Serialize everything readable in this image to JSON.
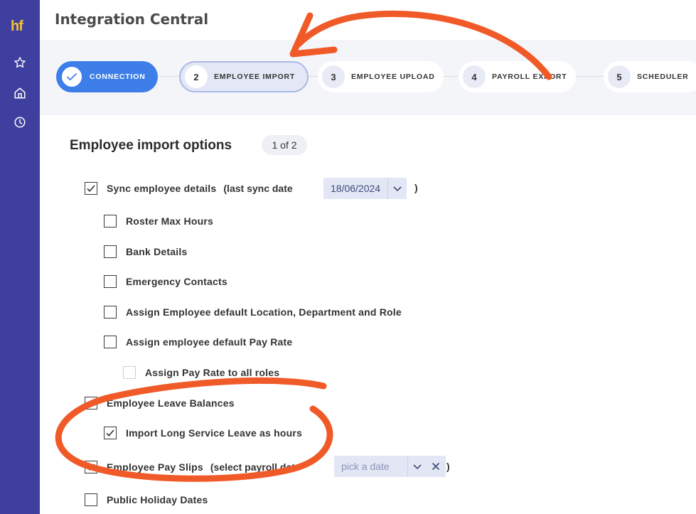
{
  "sidebar": {
    "logo": "hf",
    "icons": [
      "star-icon",
      "home-icon",
      "clock-icon"
    ]
  },
  "header": {
    "title": "Integration Central"
  },
  "stepper": {
    "steps": [
      {
        "num": "",
        "label": "CONNECTION",
        "state": "completed"
      },
      {
        "num": "2",
        "label": "EMPLOYEE IMPORT",
        "state": "current"
      },
      {
        "num": "3",
        "label": "EMPLOYEE UPLOAD",
        "state": "pending"
      },
      {
        "num": "4",
        "label": "PAYROLL EXPORT",
        "state": "pending"
      },
      {
        "num": "5",
        "label": "SCHEDULER",
        "state": "pending"
      }
    ]
  },
  "section": {
    "title": "Employee import options",
    "page_badge": "1 of 2"
  },
  "options": {
    "sync": {
      "label": "Sync employee details",
      "paren": "(last sync date",
      "date": "18/06/2024",
      "close": ")",
      "checked": true
    },
    "roster": {
      "label": "Roster Max Hours",
      "checked": false
    },
    "bank": {
      "label": "Bank Details",
      "checked": false
    },
    "emergency": {
      "label": "Emergency Contacts",
      "checked": false
    },
    "assign_default": {
      "label": "Assign Employee default Location, Department and Role",
      "checked": false
    },
    "pay_rate": {
      "label": "Assign employee default Pay Rate",
      "checked": false
    },
    "pay_rate_all": {
      "label": "Assign Pay Rate to all roles",
      "checked": false,
      "disabled": true
    },
    "leave": {
      "label": "Employee Leave Balances",
      "checked": true
    },
    "long_service": {
      "label": "Import Long Service Leave as hours",
      "checked": true
    },
    "payslips": {
      "label": "Employee Pay Slips",
      "paren": "(select payroll date",
      "placeholder": "pick a date",
      "close": ")",
      "checked": true
    },
    "holidays": {
      "label": "Public Holiday Dates",
      "checked": false
    }
  },
  "colors": {
    "sidebar": "#3f3fa0",
    "accent": "#3d7ee8",
    "annotation": "#f05a28",
    "logo": "#f2c230"
  }
}
